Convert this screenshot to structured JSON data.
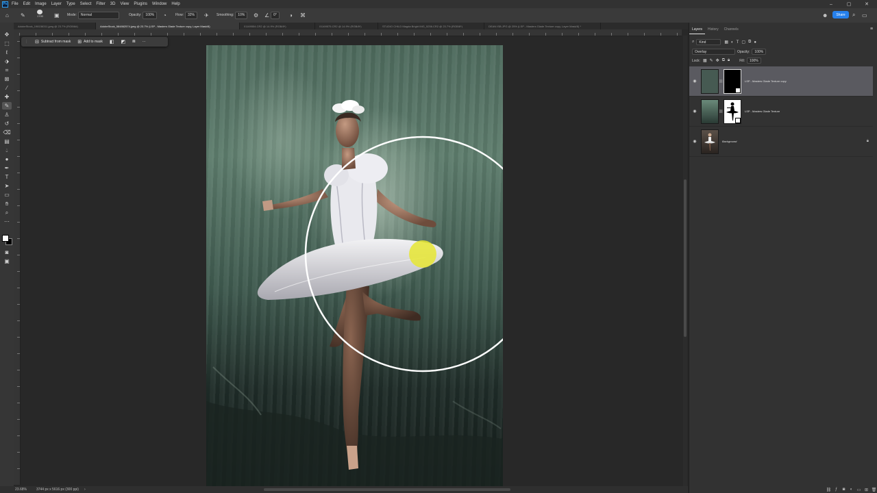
{
  "menubar": {
    "items": [
      "File",
      "Edit",
      "Image",
      "Layer",
      "Type",
      "Select",
      "Filter",
      "3D",
      "View",
      "Plugins",
      "Window",
      "Help"
    ],
    "window_controls": [
      "–",
      "▢",
      "✕"
    ]
  },
  "options": {
    "brush_size": "1700",
    "mode_label": "Mode:",
    "mode_value": "Normal",
    "opacity_label": "Opacity:",
    "opacity_value": "100%",
    "flow_label": "Flow:",
    "flow_value": "32%",
    "smoothing_label": "Smoothing:",
    "smoothing_value": "10%",
    "angle_value": "0°",
    "share_label": "Share"
  },
  "tabs": [
    {
      "label": "AdobeStock_198156311.jpeg @ 23.7% (RGB/8#)",
      "active": false
    },
    {
      "label": "AdobeStock_584862574.jpeg @ 23.7% (LSP - Masters Glade Texture copy, Layer Mask/8)",
      "active": true
    },
    {
      "label": "01169554.CR2 @ 14.9% (RGB/8*)",
      "active": false
    },
    {
      "label": "01169575.CR2 @ 14.9% (RGB/8*)",
      "active": false
    },
    {
      "label": "STUDIO CHILD Magda Bright IMG_5256.CR2 @ 23.7% (RGB/8*)",
      "active": false
    },
    {
      "label": "DEAN ISB.JPG @ 25% (LSP - Masters Glade Texture copy, Layer Mask/8) *",
      "active": false
    }
  ],
  "taskbar": {
    "subtract_label": "Subtract from mask",
    "add_label": "Add to mask",
    "more_label": "···"
  },
  "status": {
    "zoom": "23.68%",
    "dimensions": "3744 px x 5616 px (300 ppi)"
  },
  "panel": {
    "tabs": [
      "Layers",
      "History",
      "Channels"
    ],
    "filter_value": "Kind",
    "blend_mode": "Overlay",
    "opacity_label": "Opacity:",
    "opacity_value": "100%",
    "lock_label": "Lock:",
    "fill_label": "Fill:",
    "fill_value": "100%",
    "layers": [
      {
        "name": "LSP - Masters Glade Texture copy",
        "selected": true
      },
      {
        "name": "LSP - Masters Glade Texture",
        "selected": false
      },
      {
        "name": "Background",
        "selected": false
      }
    ]
  },
  "colors": {
    "accent": "#2680eb",
    "brush_cursor": "#ffffff",
    "pointer_highlight": "#e6e632"
  }
}
